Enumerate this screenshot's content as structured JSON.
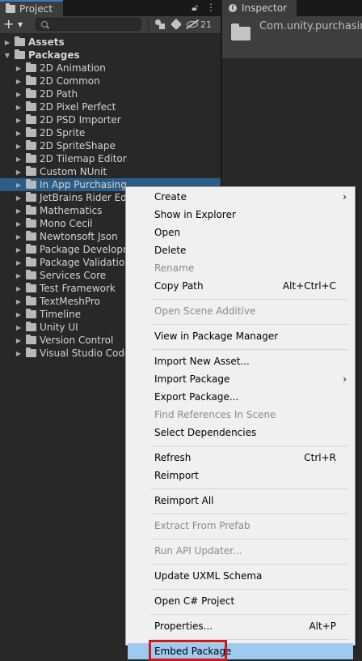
{
  "project_panel": {
    "tab_title": "Project",
    "hidden_count": "21",
    "search_placeholder": "",
    "tree": [
      {
        "label": "Assets",
        "bold": true,
        "depth": 0,
        "expanded": false
      },
      {
        "label": "Packages",
        "bold": true,
        "depth": 0,
        "expanded": true
      },
      {
        "label": "2D Animation",
        "depth": 1
      },
      {
        "label": "2D Common",
        "depth": 1
      },
      {
        "label": "2D Path",
        "depth": 1
      },
      {
        "label": "2D Pixel Perfect",
        "depth": 1
      },
      {
        "label": "2D PSD Importer",
        "depth": 1
      },
      {
        "label": "2D Sprite",
        "depth": 1
      },
      {
        "label": "2D SpriteShape",
        "depth": 1
      },
      {
        "label": "2D Tilemap Editor",
        "depth": 1
      },
      {
        "label": "Custom NUnit",
        "depth": 1
      },
      {
        "label": "In App Purchasing",
        "depth": 1,
        "selected": true
      },
      {
        "label": "JetBrains Rider Editor",
        "depth": 1
      },
      {
        "label": "Mathematics",
        "depth": 1
      },
      {
        "label": "Mono Cecil",
        "depth": 1
      },
      {
        "label": "Newtonsoft Json",
        "depth": 1
      },
      {
        "label": "Package Development",
        "depth": 1
      },
      {
        "label": "Package Validation Suite",
        "depth": 1
      },
      {
        "label": "Services Core",
        "depth": 1
      },
      {
        "label": "Test Framework",
        "depth": 1
      },
      {
        "label": "TextMeshPro",
        "depth": 1
      },
      {
        "label": "Timeline",
        "depth": 1
      },
      {
        "label": "Unity UI",
        "depth": 1
      },
      {
        "label": "Version Control",
        "depth": 1
      },
      {
        "label": "Visual Studio Code Editor",
        "depth": 1
      }
    ]
  },
  "inspector": {
    "tab_title": "Inspector",
    "object_title": "Com.unity.purchasing"
  },
  "context_menu": {
    "items": [
      {
        "label": "Create",
        "submenu": true
      },
      {
        "label": "Show in Explorer"
      },
      {
        "label": "Open"
      },
      {
        "label": "Delete"
      },
      {
        "label": "Rename",
        "disabled": true
      },
      {
        "label": "Copy Path",
        "shortcut": "Alt+Ctrl+C"
      },
      {
        "separator": true
      },
      {
        "label": "Open Scene Additive",
        "disabled": true
      },
      {
        "separator": true
      },
      {
        "label": "View in Package Manager"
      },
      {
        "separator": true
      },
      {
        "label": "Import New Asset..."
      },
      {
        "label": "Import Package",
        "submenu": true
      },
      {
        "label": "Export Package..."
      },
      {
        "label": "Find References In Scene",
        "disabled": true
      },
      {
        "label": "Select Dependencies"
      },
      {
        "separator": true
      },
      {
        "label": "Refresh",
        "shortcut": "Ctrl+R"
      },
      {
        "label": "Reimport"
      },
      {
        "separator": true
      },
      {
        "label": "Reimport All"
      },
      {
        "separator": true
      },
      {
        "label": "Extract From Prefab",
        "disabled": true
      },
      {
        "separator": true
      },
      {
        "label": "Run API Updater...",
        "disabled": true
      },
      {
        "separator": true
      },
      {
        "label": "Update UXML Schema"
      },
      {
        "separator": true
      },
      {
        "label": "Open C# Project"
      },
      {
        "separator": true
      },
      {
        "label": "Properties...",
        "shortcut": "Alt+P"
      },
      {
        "separator": true
      },
      {
        "label": "Embed Package",
        "highlighted": true,
        "boxed": true
      }
    ]
  },
  "colors": {
    "selection": "#2c5d87",
    "menu_highlight": "#9ec9f0",
    "annotation_box": "#cc1b1b"
  }
}
